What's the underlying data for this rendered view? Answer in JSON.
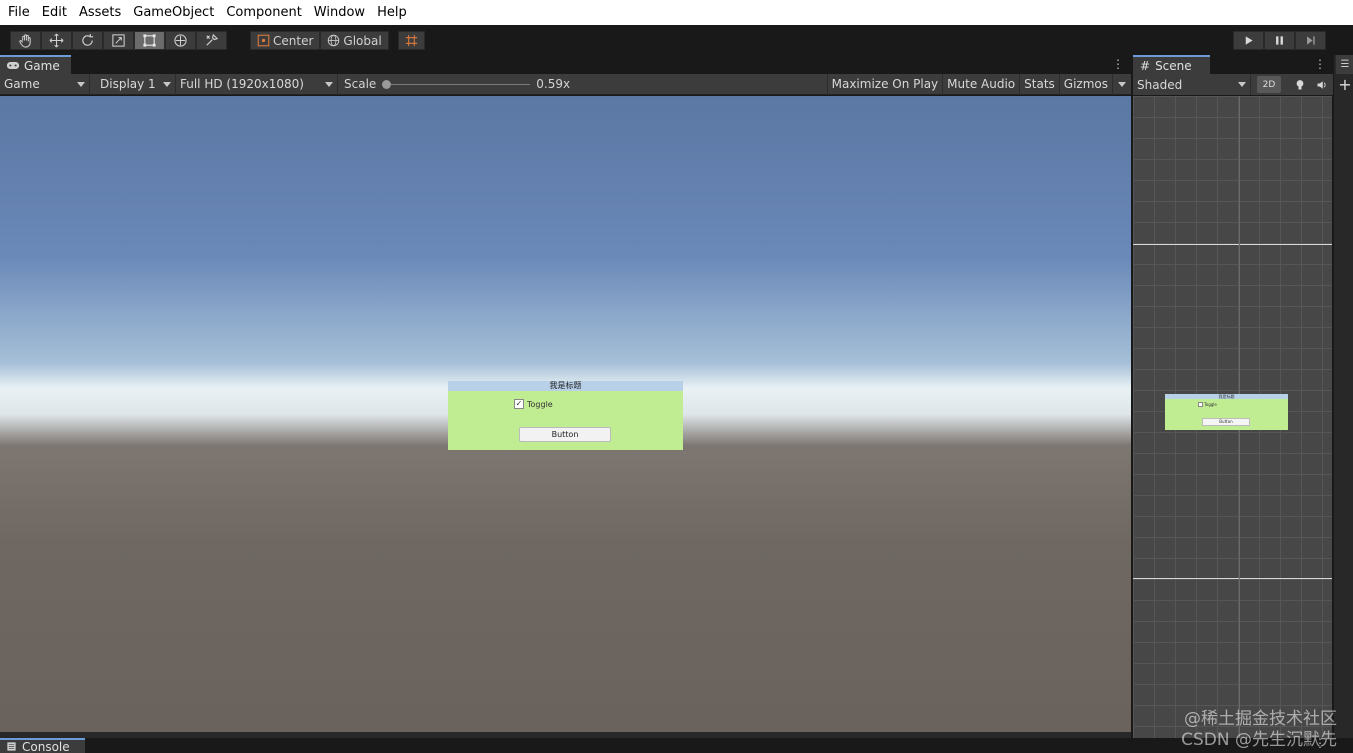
{
  "menu": {
    "items": [
      "File",
      "Edit",
      "Assets",
      "GameObject",
      "Component",
      "Window",
      "Help"
    ]
  },
  "toolbar": {
    "tools": [
      "hand-icon",
      "move-icon",
      "rotate-icon",
      "scale-icon",
      "rect-icon",
      "transform-icon",
      "custom-tool-icon"
    ],
    "active_tool": "rect-icon",
    "pivot_label": "Center",
    "space_label": "Global",
    "snap_icon": "grid-snap-icon",
    "play_icons": [
      "play-icon",
      "pause-icon",
      "step-icon"
    ]
  },
  "game": {
    "tab_label": "Game",
    "view_select": "Game",
    "display_select": "Display 1",
    "resolution_select": "Full HD (1920x1080)",
    "scale_label": "Scale",
    "scale_value": "0.59x",
    "maximize_label": "Maximize On Play",
    "mute_label": "Mute Audio",
    "stats_label": "Stats",
    "gizmos_label": "Gizmos",
    "ui_panel": {
      "title": "我是标题",
      "toggle_label": "Toggle",
      "toggle_checked": true,
      "button_label": "Button"
    }
  },
  "scene": {
    "tab_label": "Scene",
    "shading_select": "Shaded",
    "mode_2d": "2D",
    "mini_panel": {
      "title": "我是标题",
      "toggle_label": "Toggle",
      "button_label": "Button"
    }
  },
  "console": {
    "tab_label": "Console"
  },
  "watermark": {
    "line1": "@稀土掘金技术社区",
    "line2": "CSDN @先生沉默先"
  },
  "colors": {
    "panel_bg": "#3c3c3c",
    "ui_panel_green": "#c0ec92",
    "ui_title_blue": "#b8d0e8",
    "tab_accent": "#6b9cd8"
  }
}
